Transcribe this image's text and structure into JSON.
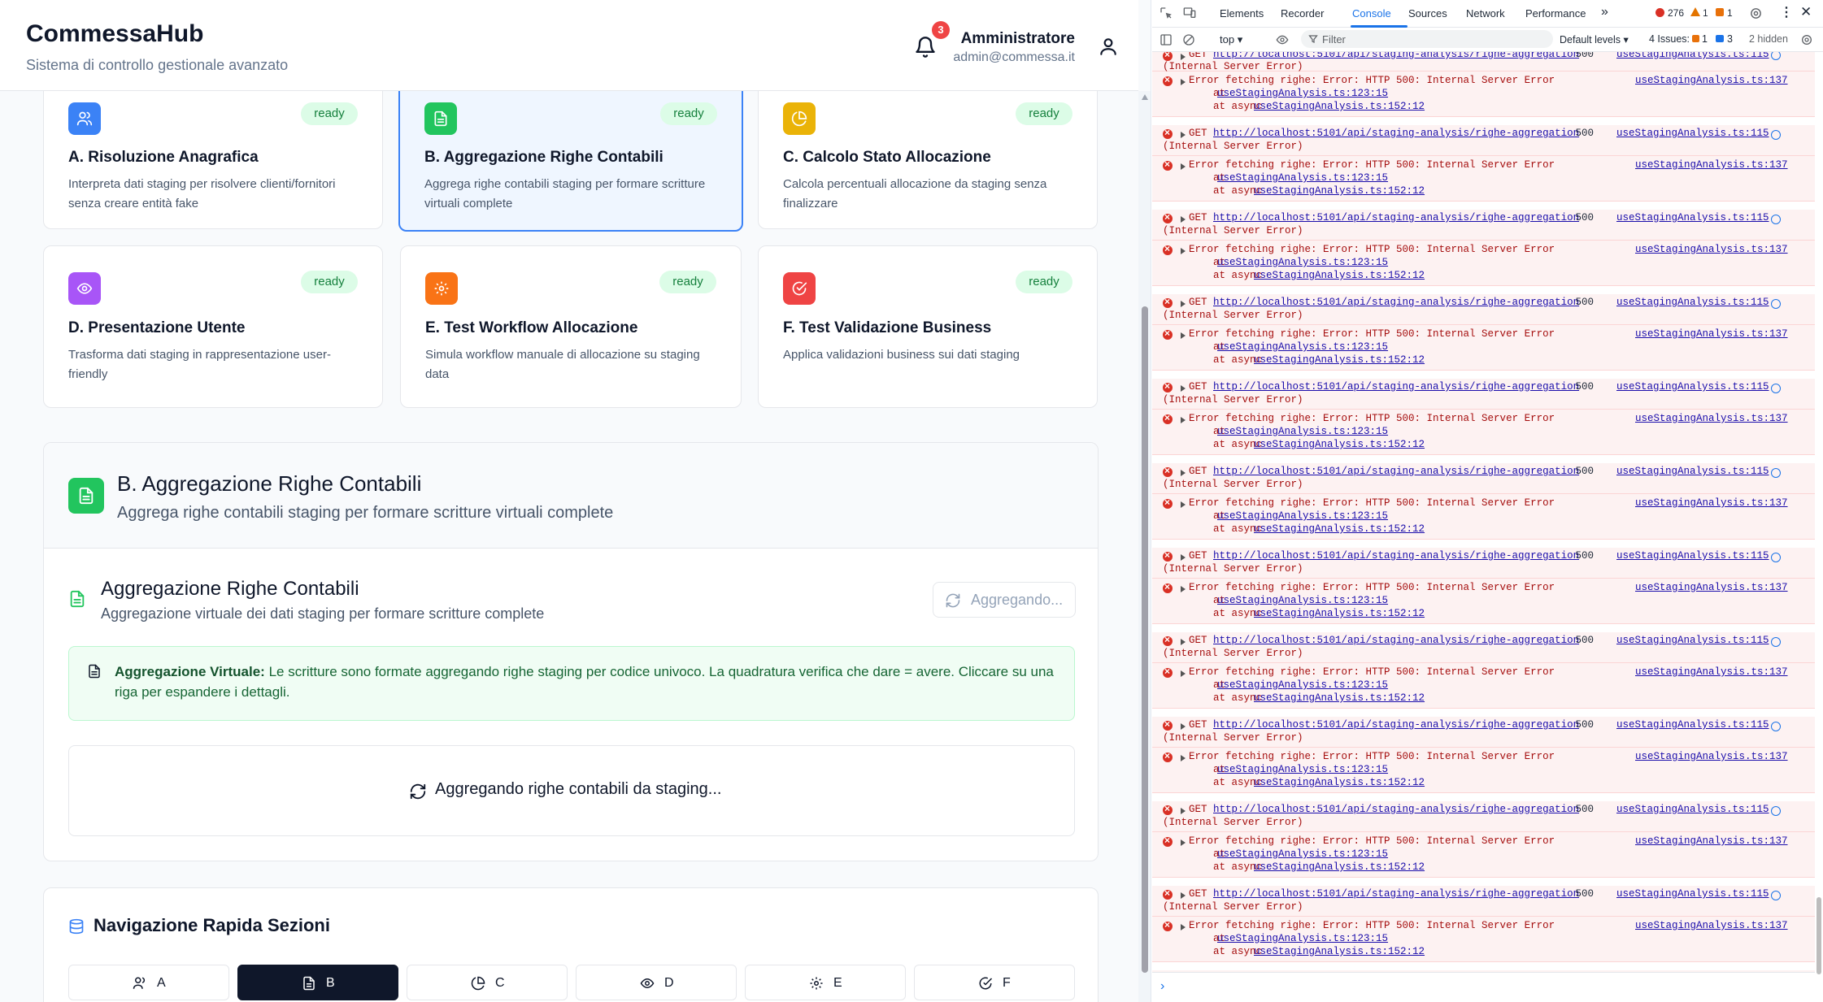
{
  "header": {
    "brand": "CommessaHub",
    "subtitle": "Sistema di controllo gestionale avanzato",
    "notification_count": "3",
    "user_name": "Amministratore",
    "user_email": "admin@commessa.it"
  },
  "cards": [
    {
      "title": "A. Risoluzione Anagrafica",
      "desc": "Interpreta dati staging per risolvere clienti/fornitori senza creare entità fake",
      "status": "ready",
      "color": "#3b82f6",
      "icon": "users-icon"
    },
    {
      "title": "B. Aggregazione Righe Contabili",
      "desc": "Aggrega righe contabili staging per formare scritture virtuali complete",
      "status": "ready",
      "color": "#22c55e",
      "icon": "document-icon"
    },
    {
      "title": "C. Calcolo Stato Allocazione",
      "desc": "Calcola percentuali allocazione da staging senza finalizzare",
      "status": "ready",
      "color": "#eab308",
      "icon": "pie-chart-icon"
    },
    {
      "title": "D. Presentazione Utente",
      "desc": "Trasforma dati staging in rappresentazione user-friendly",
      "status": "ready",
      "color": "#a855f7",
      "icon": "eye-icon"
    },
    {
      "title": "E. Test Workflow Allocazione",
      "desc": "Simula workflow manuale di allocazione su staging data",
      "status": "ready",
      "color": "#f97316",
      "icon": "gear-icon"
    },
    {
      "title": "F. Test Validazione Business",
      "desc": "Applica validazioni business sui dati staging",
      "status": "ready",
      "color": "#ef4444",
      "icon": "check-circle-icon"
    }
  ],
  "section": {
    "title": "B. Aggregazione Righe Contabili",
    "subtitle": "Aggrega righe contabili staging per formare scritture virtuali complete",
    "agg_title": "Aggregazione Righe Contabili",
    "agg_subtitle": "Aggregazione virtuale dei dati staging per formare scritture complete",
    "agg_button": "Aggregando...",
    "info_label": "Aggregazione Virtuale:",
    "info_text": " Le scritture sono formate aggregando righe staging per codice univoco. La quadratura verifica che dare = avere. Cliccare su una riga per espandere i dettagli.",
    "loading_text": "Aggregando righe contabili da staging..."
  },
  "quick_nav": {
    "title": "Navigazione Rapida Sezioni",
    "buttons": [
      "A",
      "B",
      "C",
      "D",
      "E",
      "F"
    ]
  },
  "devtools": {
    "tabs": [
      "Elements",
      "Recorder",
      "Console",
      "Sources",
      "Network",
      "Performance"
    ],
    "active_tab": "Console",
    "error_count": "276",
    "warning_count": "1",
    "info_count": "1",
    "context": "top",
    "filter_placeholder": "Filter",
    "levels": "Default levels",
    "issues_label": "4 Issues:",
    "issues_errors": "1",
    "issues_info": "3",
    "hidden": "2 hidden",
    "get_prefix": "GET ",
    "get_url": "http://localhost:5101/api/staging-analysis/righe-aggregation",
    "get_status": " 500",
    "get_status_text": "(Internal Server Error)",
    "get_source": "useStagingAnalysis.ts:115",
    "error_msg": "Error fetching righe: Error: HTTP 500: Internal Server Error",
    "error_source": "useStagingAnalysis.ts:137",
    "stack_at": "    at ",
    "stack_1": "useStagingAnalysis.ts:123:15",
    "stack_async": "    at async ",
    "stack_2": "useStagingAnalysis.ts:152:12",
    "prompt": "›"
  }
}
